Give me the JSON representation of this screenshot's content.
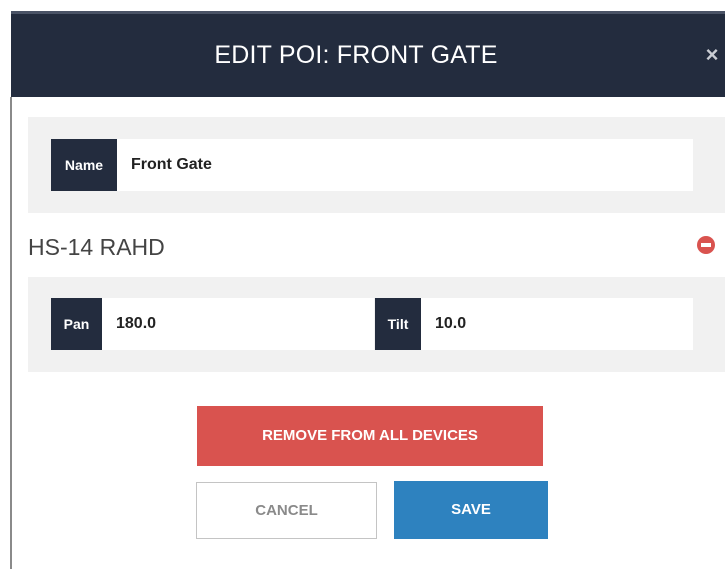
{
  "modal": {
    "title": "EDIT POI: FRONT GATE",
    "close_glyph": "×",
    "close_icon": "close-icon"
  },
  "name_field": {
    "label": "Name",
    "value": "Front Gate"
  },
  "device": {
    "title": "HS-14 RAHD",
    "remove_icon": "minus-circle-icon",
    "pan": {
      "label": "Pan",
      "value": "180.0"
    },
    "tilt": {
      "label": "Tilt",
      "value": "10.0"
    }
  },
  "actions": {
    "remove_all_label": "REMOVE FROM ALL DEVICES",
    "cancel_label": "CANCEL",
    "save_label": "SAVE"
  },
  "colors": {
    "header_bg": "#232c3e",
    "danger": "#d9534f",
    "primary": "#2e82bf",
    "panel_bg": "#f1f1f1"
  }
}
